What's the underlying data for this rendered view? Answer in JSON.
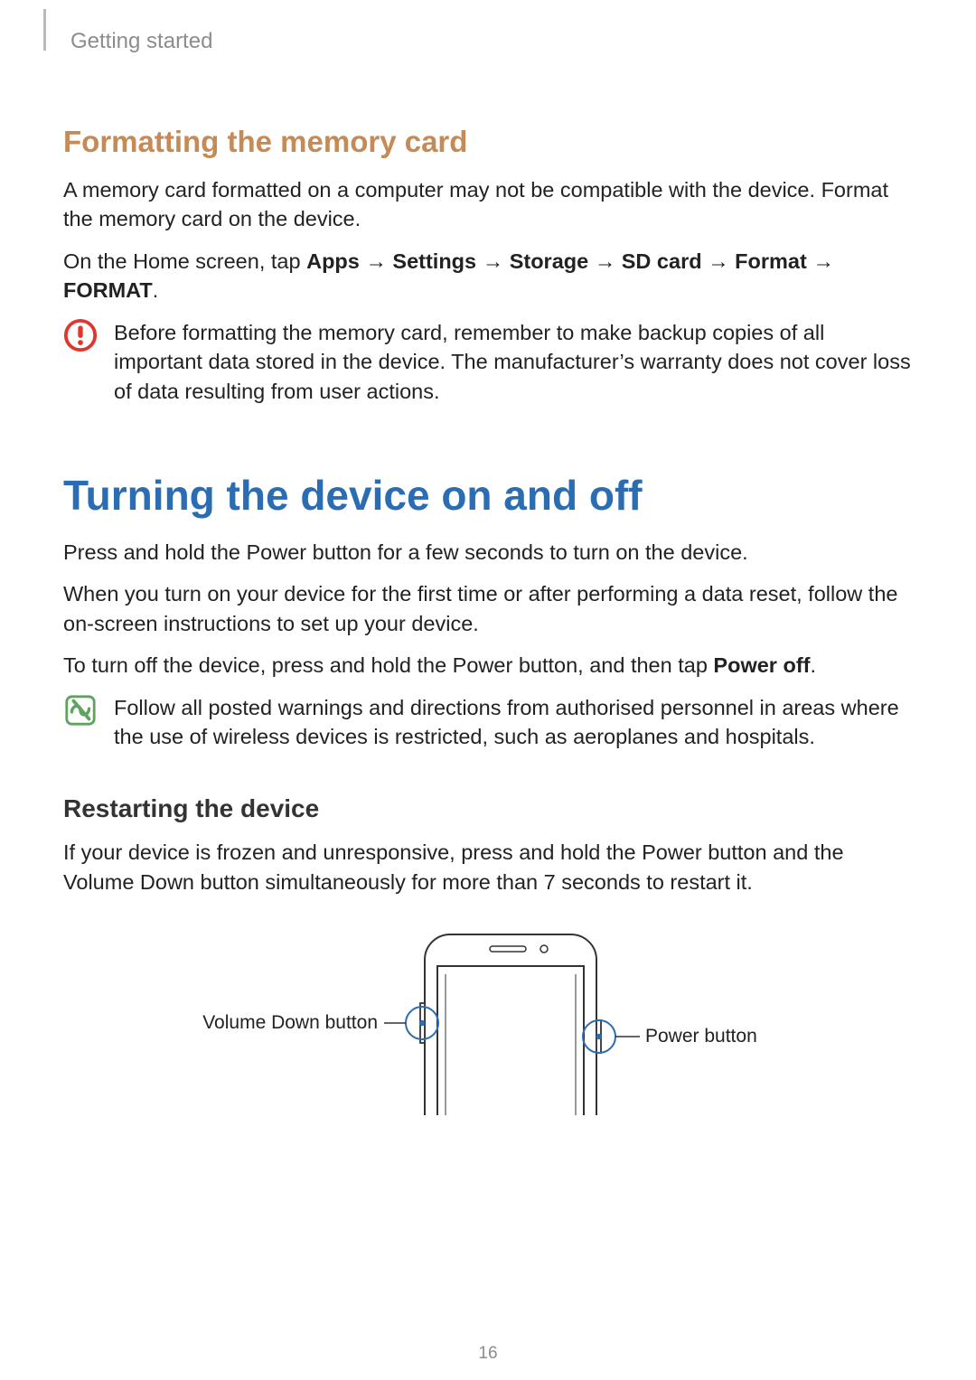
{
  "header": {
    "section_title": "Getting started"
  },
  "section1": {
    "title": "Formatting the memory card",
    "p1": "A memory card formatted on a computer may not be compatible with the device. Format the memory card on the device.",
    "instruction_prefix": "On the Home screen, tap ",
    "instruction_path": [
      "Apps",
      "Settings",
      "Storage",
      "SD card",
      "Format",
      "FORMAT"
    ],
    "instruction_arrow": " → ",
    "warning": "Before formatting the memory card, remember to make backup copies of all important data stored in the device. The manufacturer’s warranty does not cover loss of data resulting from user actions."
  },
  "section2": {
    "title": "Turning the device on and off",
    "p1": "Press and hold the Power button for a few seconds to turn on the device.",
    "p2": "When you turn on your device for the first time or after performing a data reset, follow the on-screen instructions to set up your device.",
    "p3_pre": "To turn off the device, press and hold the Power button, and then tap ",
    "p3_bold": "Power off",
    "p3_post": ".",
    "note": "Follow all posted warnings and directions from authorised personnel in areas where the use of wireless devices is restricted, such as aeroplanes and hospitals."
  },
  "section3": {
    "title": "Restarting the device",
    "p1": "If your device is frozen and unresponsive, press and hold the Power button and the Volume Down button simultaneously for more than 7 seconds to restart it."
  },
  "diagram": {
    "left_label": "Volume Down button",
    "right_label": "Power button"
  },
  "page_number": "16"
}
